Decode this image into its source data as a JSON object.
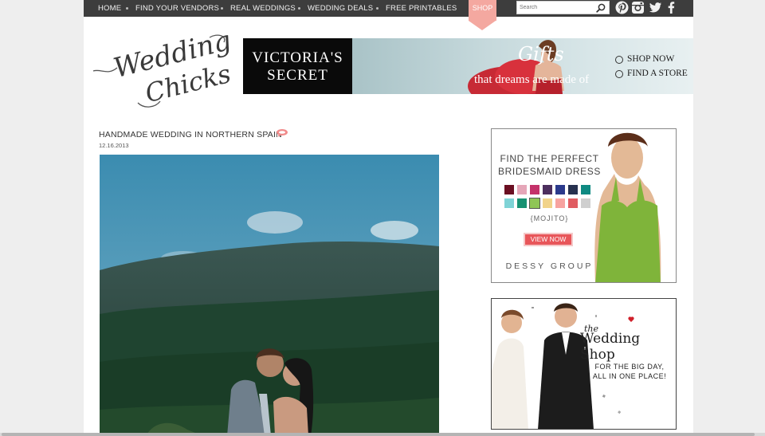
{
  "nav": {
    "items": [
      "HOME",
      "FIND YOUR VENDORS",
      "REAL WEDDINGS",
      "WEDDING DEALS",
      "FREE PRINTABLES"
    ],
    "shop_label": "SHOP",
    "search_placeholder": "Search",
    "social_icons": [
      "pinterest-icon",
      "instagram-icon",
      "twitter-icon",
      "facebook-icon"
    ]
  },
  "logo": {
    "text_line1": "Wedding",
    "text_line2": "Chicks"
  },
  "banner": {
    "brand_line1": "VICTORIA'S",
    "brand_line2": "SECRET",
    "headline": "Gifts",
    "tagline": "that dreams are made of",
    "link1": "SHOP NOW",
    "link2": "FIND A STORE"
  },
  "post": {
    "title": "HANDMADE WEDDING IN NORTHERN SPAIN",
    "date": "12.16.2013"
  },
  "sidebar_ad1": {
    "title_line1": "FIND THE PERFECT",
    "title_line2": "BRIDESMAID DRESS",
    "swatch_colors": [
      "#6b0f22",
      "#e5a6b8",
      "#c4326a",
      "#4d2f5e",
      "#2b3a8c",
      "#27314f",
      "#0f8a82",
      "#7fd3d6",
      "#179172",
      "#8fc556",
      "#f1d38a",
      "#f7a3a0",
      "#e05d62",
      "#cfcfcf"
    ],
    "selected_color": "{MOJITO}",
    "button": "VIEW NOW",
    "brand": "DESSY GROUP"
  },
  "sidebar_ad2": {
    "the": "the",
    "name": "Wedding Shop",
    "line1": "FOR THE BIG DAY,",
    "line2": "ALL IN ONE PLACE!"
  },
  "colors": {
    "nav_bg": "#3d3d3d",
    "accent": "#f4a8a0",
    "button_red": "#e8565a"
  }
}
